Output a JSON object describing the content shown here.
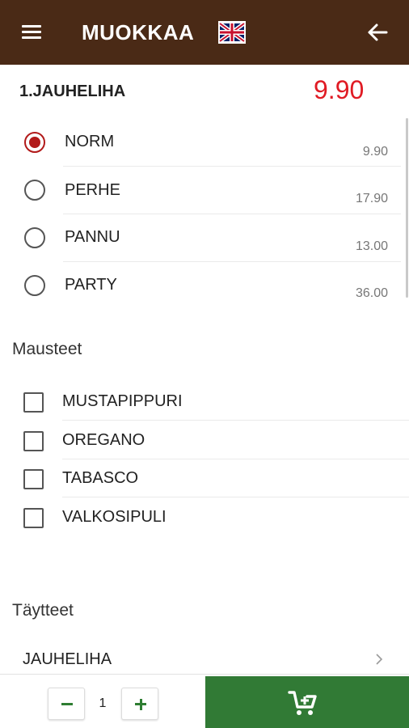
{
  "header": {
    "title": "MUOKKAA",
    "menu_icon": "hamburger-menu-icon",
    "language_icon": "uk-flag-icon",
    "back_icon": "back-arrow-icon",
    "background_color": "#4a2a16"
  },
  "product": {
    "name": "1.JAUHELIHA",
    "price": "9.90",
    "price_color": "#e01b24"
  },
  "sizes": [
    {
      "label": "NORM",
      "price": "9.90",
      "selected": true
    },
    {
      "label": "PERHE",
      "price": "17.90",
      "selected": false
    },
    {
      "label": "PANNU",
      "price": "13.00",
      "selected": false
    },
    {
      "label": "PARTY",
      "price": "36.00",
      "selected": false
    }
  ],
  "spices": {
    "title": "Mausteet",
    "items": [
      {
        "label": "MUSTAPIPPURI",
        "checked": false
      },
      {
        "label": "OREGANO",
        "checked": false
      },
      {
        "label": "TABASCO",
        "checked": false
      },
      {
        "label": "VALKOSIPULI",
        "checked": false
      }
    ]
  },
  "fillings": {
    "title": "Täytteet",
    "items": [
      {
        "label": "JAUHELIHA"
      }
    ]
  },
  "bottom": {
    "quantity": "1",
    "minus_icon": "minus-icon",
    "plus_icon": "plus-icon",
    "cart_icon": "add-to-cart-icon",
    "accent_color": "#317a35"
  }
}
